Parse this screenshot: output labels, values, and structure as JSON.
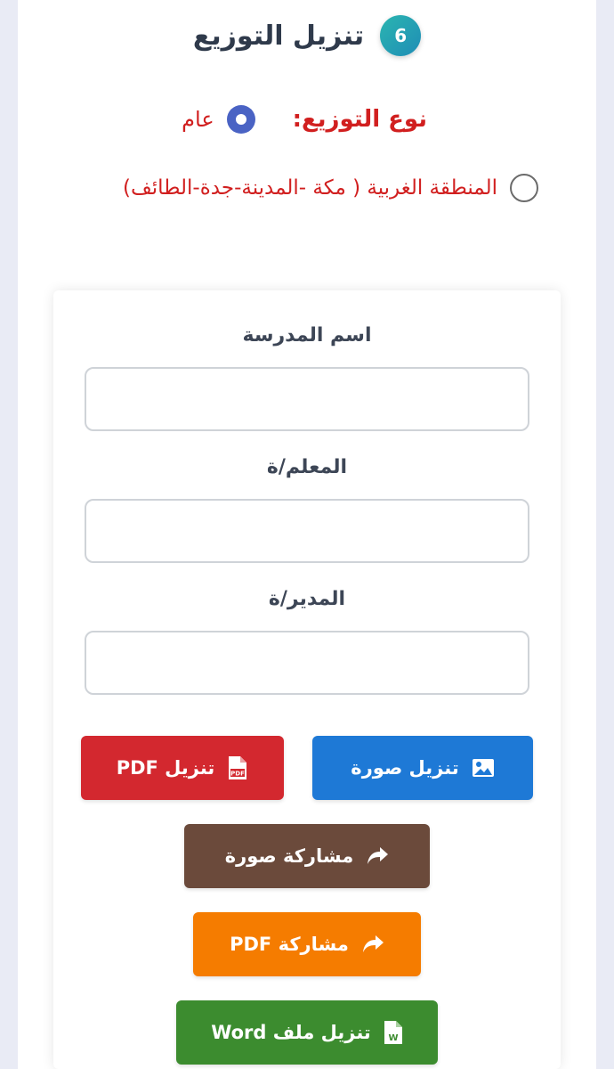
{
  "section": {
    "step_number": "6",
    "title": "تنزيل التوزيع"
  },
  "distribution_type": {
    "label": "نوع التوزيع:",
    "options": [
      {
        "label": "عام",
        "selected": true
      },
      {
        "label": "المنطقة الغربية ( مكة -المدينة-جدة-الطائف)",
        "selected": false
      }
    ]
  },
  "form": {
    "school_name_label": "اسم المدرسة",
    "school_name_value": "",
    "teacher_label": "المعلم/ة",
    "teacher_value": "",
    "principal_label": "المدير/ة",
    "principal_value": ""
  },
  "actions": {
    "download_image": "تنزيل صورة",
    "download_pdf": "تنزيل PDF",
    "share_image": "مشاركة صورة",
    "share_pdf": "مشاركة PDF",
    "download_word": "تنزيل ملف Word"
  },
  "icons": {
    "download_image": "image-icon",
    "download_pdf": "pdf-file-icon",
    "share_image": "share-arrow-icon",
    "share_pdf": "share-arrow-icon",
    "download_word": "word-file-icon"
  },
  "colors": {
    "download_image": "#1e79d6",
    "download_pdf": "#d3282f",
    "share_image": "#6b4a3b",
    "share_pdf": "#f57c00",
    "download_word": "#3c8c2f",
    "accent_red_text": "#d11f1f",
    "radio_selected": "#4a63c4"
  }
}
